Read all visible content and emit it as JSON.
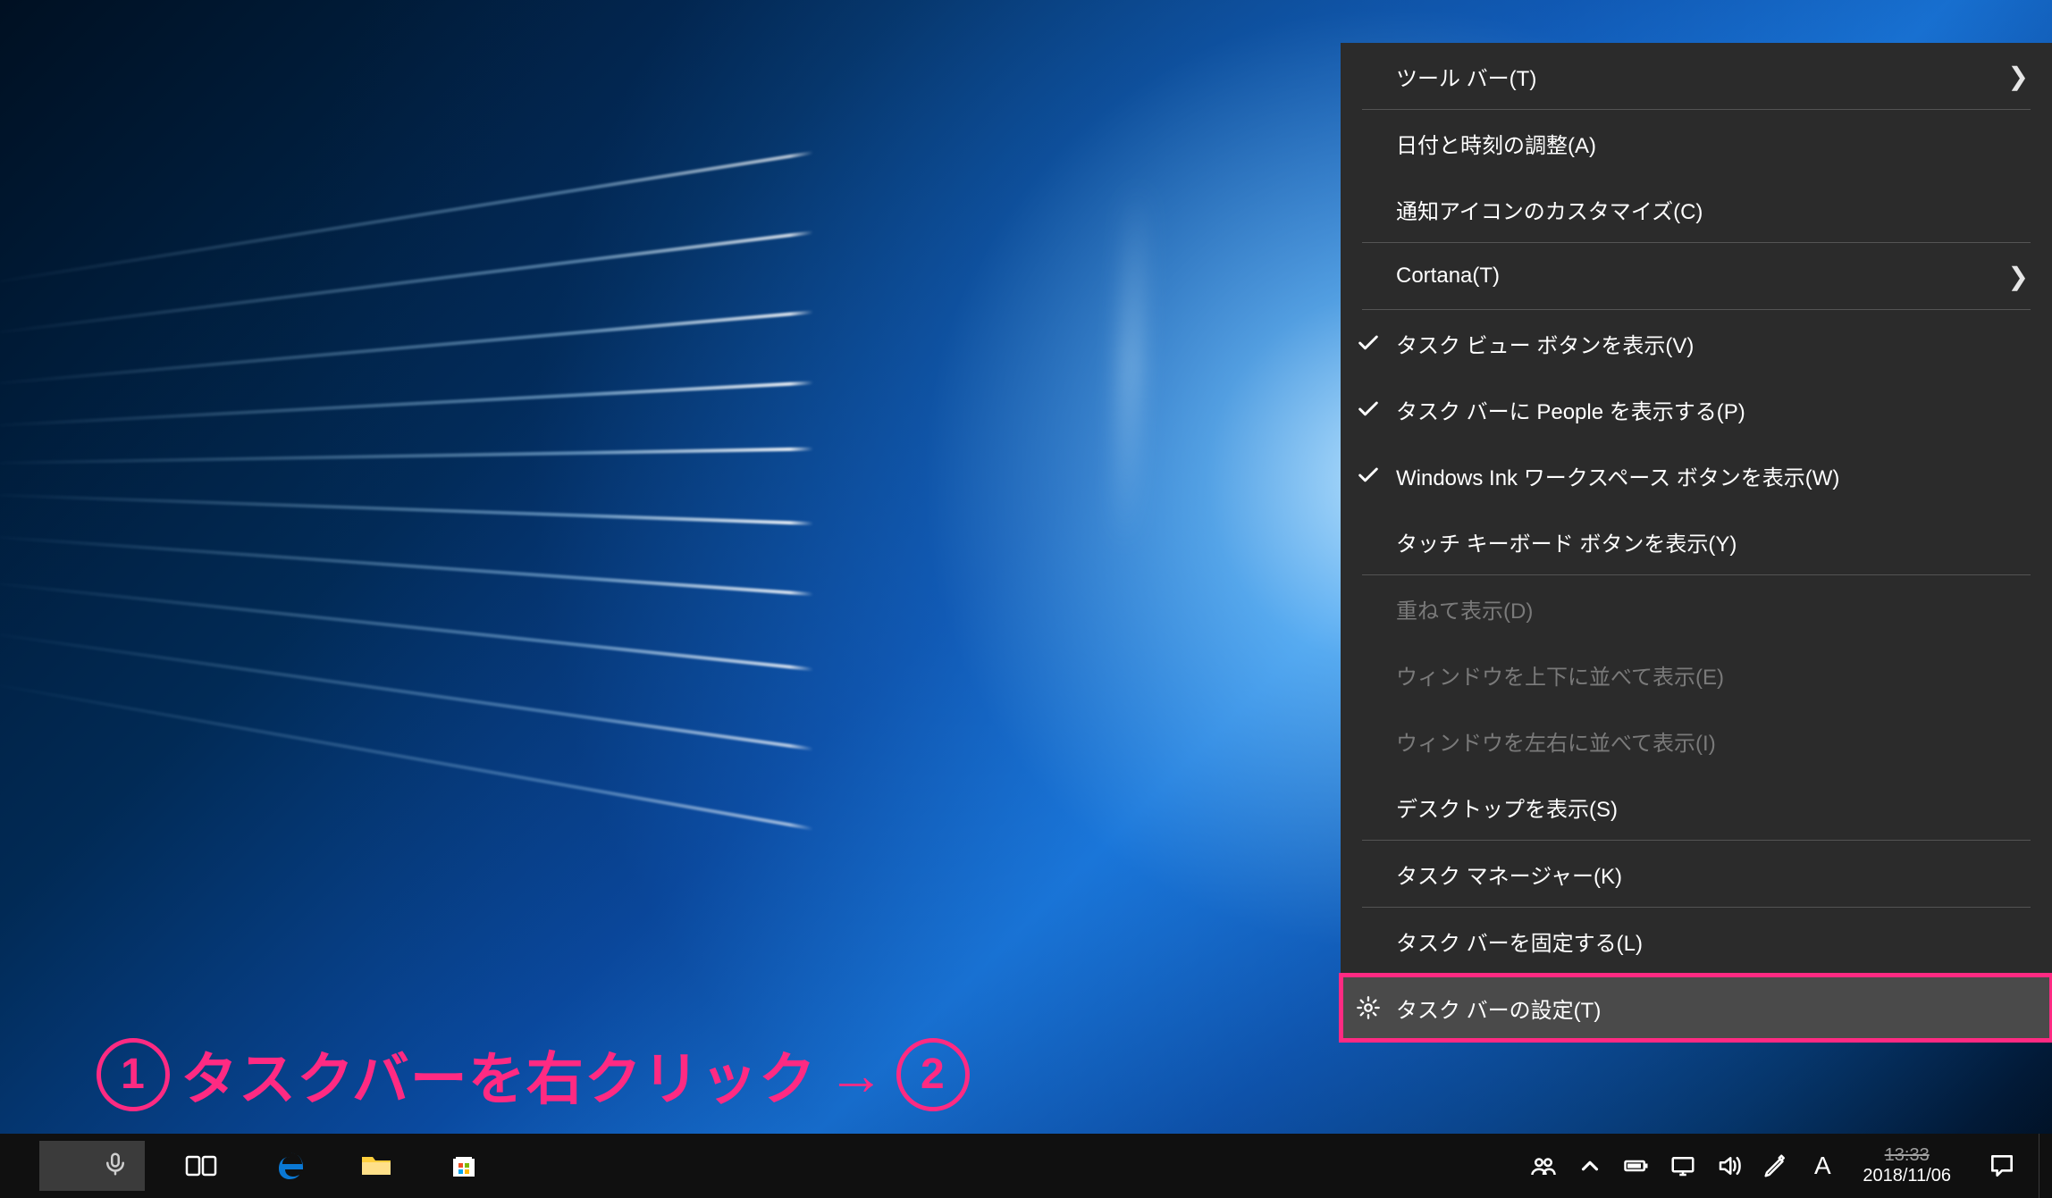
{
  "context_menu": {
    "items": [
      {
        "label": "ツール バー(T)",
        "submenu": true
      },
      {
        "sep": true
      },
      {
        "label": "日付と時刻の調整(A)"
      },
      {
        "label": "通知アイコンのカスタマイズ(C)"
      },
      {
        "sep": true
      },
      {
        "label": "Cortana(T)",
        "submenu": true
      },
      {
        "sep": true
      },
      {
        "label": "タスク ビュー ボタンを表示(V)",
        "checked": true
      },
      {
        "label": "タスク バーに People を表示する(P)",
        "checked": true
      },
      {
        "label": "Windows Ink ワークスペース ボタンを表示(W)",
        "checked": true
      },
      {
        "label": "タッチ キーボード ボタンを表示(Y)"
      },
      {
        "sep": true
      },
      {
        "label": "重ねて表示(D)",
        "disabled": true
      },
      {
        "label": "ウィンドウを上下に並べて表示(E)",
        "disabled": true
      },
      {
        "label": "ウィンドウを左右に並べて表示(I)",
        "disabled": true
      },
      {
        "label": "デスクトップを表示(S)"
      },
      {
        "sep": true
      },
      {
        "label": "タスク マネージャー(K)"
      },
      {
        "sep": true
      },
      {
        "label": "タスク バーを固定する(L)"
      },
      {
        "sep": true
      },
      {
        "label": "タスク バーの設定(T)",
        "icon": "gear",
        "hover": true
      }
    ]
  },
  "annotation": {
    "num1": "1",
    "text1": "タスクバーを右クリック",
    "arrow": "→",
    "num2": "2"
  },
  "taskbar": {
    "clock": {
      "time": "13:33",
      "date": "2018/11/06"
    },
    "ime": "A"
  }
}
